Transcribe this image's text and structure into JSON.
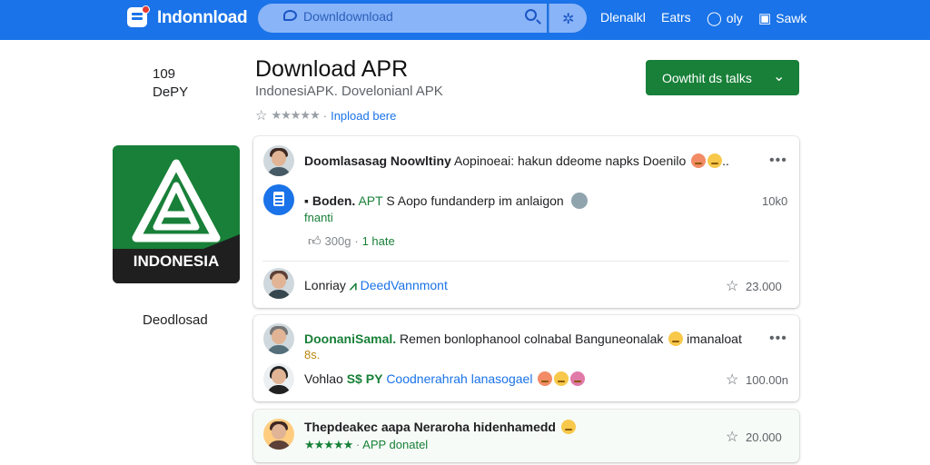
{
  "topbar": {
    "logo_text": "Indonnload",
    "search_placeholder": "Downldownload",
    "nav": [
      {
        "label": "Dlenalkl",
        "icon": ""
      },
      {
        "label": "Eatrs",
        "icon": ""
      },
      {
        "label": "oly",
        "icon": "chat-icon"
      },
      {
        "label": "Sawk",
        "icon": "save-icon"
      }
    ]
  },
  "sidebar": {
    "line1": "109",
    "line2": "DePY",
    "app_icon_label": "INDONESIA",
    "download_label": "Deodlosad"
  },
  "header": {
    "title": "Download APR",
    "subtitle": "IndonesiAPK. Dovelonianl APK",
    "rating_stars": "★★★★★",
    "rating_link": "Inpload bere",
    "install_button": "Oowthit ds talks"
  },
  "cards": [
    {
      "comment": {
        "name": "Doomlasasag Noowltiny",
        "text": "Aopinoeai: hakun ddeome napks Doenilo"
      },
      "more": "•••",
      "reply": {
        "name": "Boden.",
        "tag": "APT",
        "text": "S Aopo fundanderp im anlaigon",
        "second_line": "fnanti",
        "count": "10k0"
      },
      "actions": {
        "likes": "300g",
        "sep": "·",
        "link": "1 hate"
      },
      "footer": {
        "name": "Lonriay",
        "link": "DeedVannmont",
        "count": "23.000"
      }
    },
    {
      "comment": {
        "name": "DoonaniSamal.",
        "text": "Remen bonlophanool colnabal Banguneonalak",
        "after": "imanaloat",
        "second_line": "8s."
      },
      "more": "•••",
      "reply": {
        "name": "Vohlao",
        "tag": "S$ PY",
        "text": "Coodnerahrah lanasogael",
        "count": "100.00n"
      }
    },
    {
      "comment": {
        "name": "Thepdeakec aapa Neraroha hidenhamedd",
        "stars": "★★★★★",
        "sep": "·",
        "link": "APP donatel",
        "count": "20.000"
      }
    }
  ],
  "colors": {
    "topbar": "#1a73e8",
    "install": "#188038",
    "link": "#1a73e8"
  }
}
